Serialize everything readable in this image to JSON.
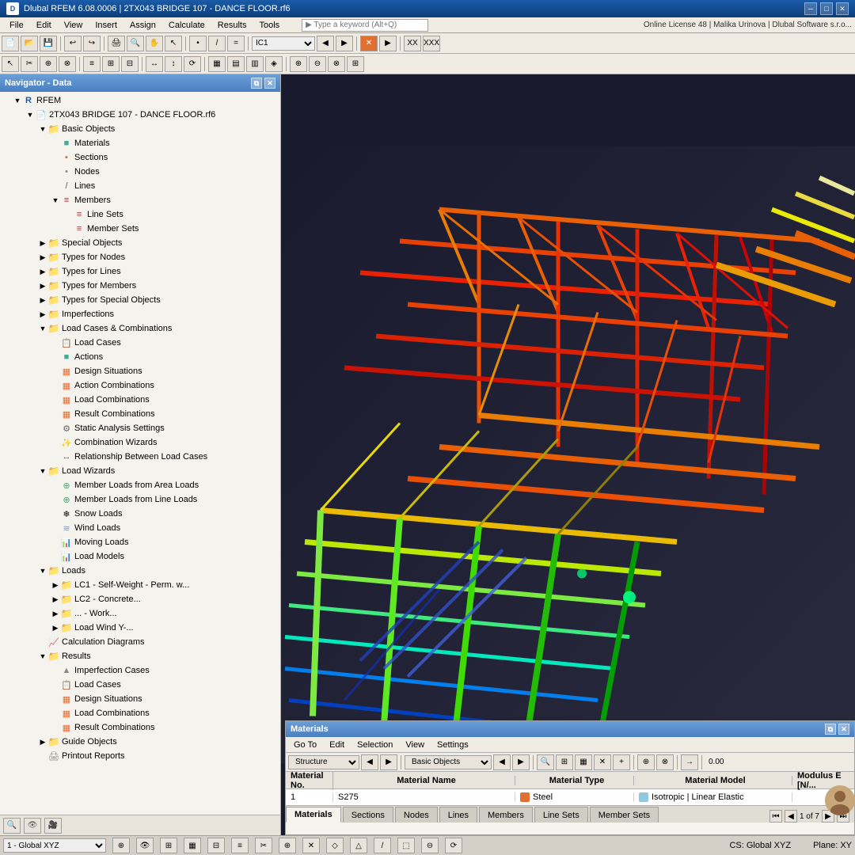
{
  "titlebar": {
    "icon": "D",
    "title": "Dlubal RFEM 6.08.0006 | 2TX043 BRIDGE 107 - DANCE FLOOR.rf6",
    "min": "─",
    "max": "□",
    "close": "✕"
  },
  "menubar": {
    "items": [
      "File",
      "Edit",
      "View",
      "Insert",
      "Assign",
      "Calculate",
      "Results",
      "Tools"
    ],
    "search_placeholder": "▶ Type a keyword (Alt+Q)",
    "right_text": "Online License 48 | Malika Urinova | Dlubal Software s.r.o..."
  },
  "navigator": {
    "title": "Navigator - Data",
    "rfem_label": "RFEM",
    "file_label": "2TX043 BRIDGE 107 - DANCE FLOOR.rf6",
    "tree": [
      {
        "id": "basic-objects",
        "label": "Basic Objects",
        "level": 1,
        "type": "folder",
        "expanded": true
      },
      {
        "id": "materials",
        "label": "Materials",
        "level": 2,
        "type": "item"
      },
      {
        "id": "sections",
        "label": "Sections",
        "level": 2,
        "type": "item"
      },
      {
        "id": "nodes",
        "label": "Nodes",
        "level": 2,
        "type": "item"
      },
      {
        "id": "lines",
        "label": "Lines",
        "level": 2,
        "type": "item"
      },
      {
        "id": "members",
        "label": "Members",
        "level": 2,
        "type": "folder",
        "expanded": true
      },
      {
        "id": "line-sets",
        "label": "Line Sets",
        "level": 3,
        "type": "item"
      },
      {
        "id": "member-sets",
        "label": "Member Sets",
        "level": 3,
        "type": "item"
      },
      {
        "id": "special-objects",
        "label": "Special Objects",
        "level": 1,
        "type": "folder"
      },
      {
        "id": "types-nodes",
        "label": "Types for Nodes",
        "level": 1,
        "type": "folder"
      },
      {
        "id": "types-lines",
        "label": "Types for Lines",
        "level": 1,
        "type": "folder"
      },
      {
        "id": "types-members",
        "label": "Types for Members",
        "level": 1,
        "type": "folder"
      },
      {
        "id": "types-special",
        "label": "Types for Special Objects",
        "level": 1,
        "type": "folder"
      },
      {
        "id": "imperfections",
        "label": "Imperfections",
        "level": 1,
        "type": "folder"
      },
      {
        "id": "load-cases-comb",
        "label": "Load Cases & Combinations",
        "level": 1,
        "type": "folder",
        "expanded": true
      },
      {
        "id": "load-cases",
        "label": "Load Cases",
        "level": 2,
        "type": "item"
      },
      {
        "id": "actions",
        "label": "Actions",
        "level": 2,
        "type": "item"
      },
      {
        "id": "design-situations",
        "label": "Design Situations",
        "level": 2,
        "type": "item"
      },
      {
        "id": "action-combinations",
        "label": "Action Combinations",
        "level": 2,
        "type": "item"
      },
      {
        "id": "load-combinations",
        "label": "Load Combinations",
        "level": 2,
        "type": "item"
      },
      {
        "id": "result-combinations",
        "label": "Result Combinations",
        "level": 2,
        "type": "item"
      },
      {
        "id": "static-analysis",
        "label": "Static Analysis Settings",
        "level": 2,
        "type": "item"
      },
      {
        "id": "combination-wizards",
        "label": "Combination Wizards",
        "level": 2,
        "type": "item"
      },
      {
        "id": "relationship-load-cases",
        "label": "Relationship Between Load Cases",
        "level": 2,
        "type": "item"
      },
      {
        "id": "load-wizards",
        "label": "Load Wizards",
        "level": 1,
        "type": "folder",
        "expanded": true
      },
      {
        "id": "member-loads-area",
        "label": "Member Loads from Area Loads",
        "level": 2,
        "type": "item"
      },
      {
        "id": "member-loads-line",
        "label": "Member Loads from Line Loads",
        "level": 2,
        "type": "item"
      },
      {
        "id": "snow-loads",
        "label": "Snow Loads",
        "level": 2,
        "type": "item"
      },
      {
        "id": "wind-loads",
        "label": "Wind Loads",
        "level": 2,
        "type": "item"
      },
      {
        "id": "moving-loads",
        "label": "Moving Loads",
        "level": 2,
        "type": "item"
      },
      {
        "id": "load-models",
        "label": "Load Models",
        "level": 2,
        "type": "item"
      },
      {
        "id": "loads",
        "label": "Loads",
        "level": 1,
        "type": "folder",
        "expanded": true
      },
      {
        "id": "lc1-self",
        "label": "LC1 - Self-Weight - Perm. w...",
        "level": 2,
        "type": "folder"
      },
      {
        "id": "lc2-concrete",
        "label": "LC2 - Concrete...",
        "level": 2,
        "type": "folder"
      },
      {
        "id": "lc3-work",
        "label": "... - Work...",
        "level": 2,
        "type": "folder"
      },
      {
        "id": "lc4-wind",
        "label": "Load Wind Y-...",
        "level": 2,
        "type": "folder"
      },
      {
        "id": "calc-diagrams",
        "label": "Calculation Diagrams",
        "level": 1,
        "type": "item"
      },
      {
        "id": "results",
        "label": "Results",
        "level": 1,
        "type": "folder",
        "expanded": true
      },
      {
        "id": "imperfection-cases",
        "label": "Imperfection Cases",
        "level": 2,
        "type": "item"
      },
      {
        "id": "result-load-cases",
        "label": "Load Cases",
        "level": 2,
        "type": "item"
      },
      {
        "id": "result-design-situations",
        "label": "Design Situations",
        "level": 2,
        "type": "item"
      },
      {
        "id": "result-load-combinations",
        "label": "Load Combinations",
        "level": 2,
        "type": "item"
      },
      {
        "id": "result-result-combinations",
        "label": "Result Combinations",
        "level": 2,
        "type": "item"
      },
      {
        "id": "guide-objects",
        "label": "Guide Objects",
        "level": 1,
        "type": "folder"
      },
      {
        "id": "printout-reports",
        "label": "Printout Reports",
        "level": 1,
        "type": "item"
      }
    ]
  },
  "materials_panel": {
    "title": "Materials",
    "menus": [
      "Go To",
      "Edit",
      "Selection",
      "View",
      "Settings"
    ],
    "structure_combo": "Structure",
    "basic_objects_combo": "Basic Objects",
    "table_headers": [
      "Material No.",
      "Material Name",
      "Material Type",
      "Material Model",
      "Modulus E [N/..."
    ],
    "rows": [
      {
        "no": "1",
        "name": "S275",
        "type": "Steel",
        "type_color": "#e07030",
        "model": "Isotropic | Linear Elastic",
        "model_color": "#90c8e0",
        "e": ""
      }
    ],
    "pagination": "1 of 7",
    "tabs": [
      "Materials",
      "Sections",
      "Nodes",
      "Lines",
      "Members",
      "Line Sets",
      "Member Sets"
    ]
  },
  "statusbar": {
    "coord_system": "1 - Global XYZ",
    "cs_label": "CS: Global XYZ",
    "plane_label": "Plane: XY"
  }
}
